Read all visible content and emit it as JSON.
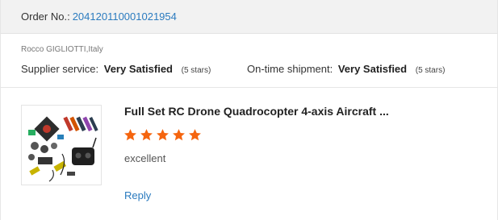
{
  "order": {
    "label": "Order No.:",
    "number": "204120110001021954"
  },
  "buyer": {
    "name": "Rocco GIGLIOTTI,Italy"
  },
  "ratings": {
    "supplier": {
      "label": "Supplier service:",
      "value": "Very Satisfied",
      "stars_text": "(5 stars)"
    },
    "shipment": {
      "label": "On-time shipment:",
      "value": "Very Satisfied",
      "stars_text": "(5 stars)"
    }
  },
  "product": {
    "title": "Full Set RC Drone Quadrocopter 4-axis Aircraft ...",
    "rating": 5,
    "rating_max": 5,
    "feedback": "excellent",
    "reply_label": "Reply",
    "thumbnail_icon": "drone-kit-product-photo"
  },
  "colors": {
    "link": "#2b7bbf",
    "star": "#f5650f",
    "header_bg": "#f2f2f2"
  }
}
